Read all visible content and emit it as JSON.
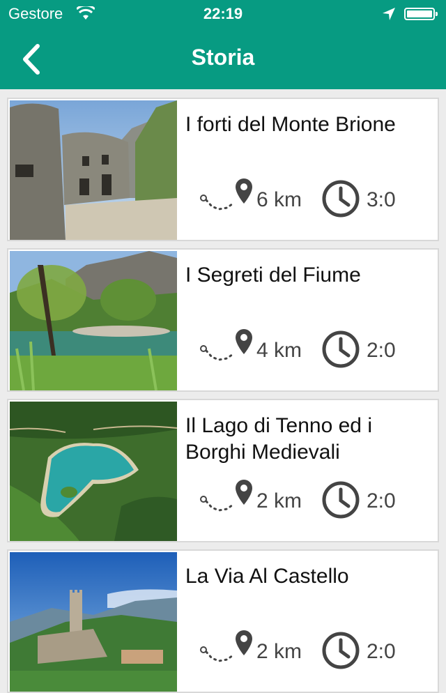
{
  "status_bar": {
    "carrier": "Gestore",
    "time": "22:19"
  },
  "nav": {
    "title": "Storia"
  },
  "items": [
    {
      "title": "I forti del Monte Brione",
      "distance": "6 km",
      "duration": "3:0"
    },
    {
      "title": "I Segreti del Fiume",
      "distance": "4 km",
      "duration": "2:0"
    },
    {
      "title": "Il Lago di Tenno ed i Borghi Medievali",
      "distance": "2 km",
      "duration": "2:0"
    },
    {
      "title": "La Via Al Castello",
      "distance": "2 km",
      "duration": "2:0"
    }
  ],
  "icons": {
    "back": "chevron-left-icon",
    "route": "route-pin-icon",
    "clock": "clock-icon",
    "wifi": "wifi-icon",
    "location": "location-arrow-icon",
    "battery": "battery-icon"
  },
  "colors": {
    "header": "#079b82",
    "background": "#ececec",
    "card": "#ffffff"
  }
}
